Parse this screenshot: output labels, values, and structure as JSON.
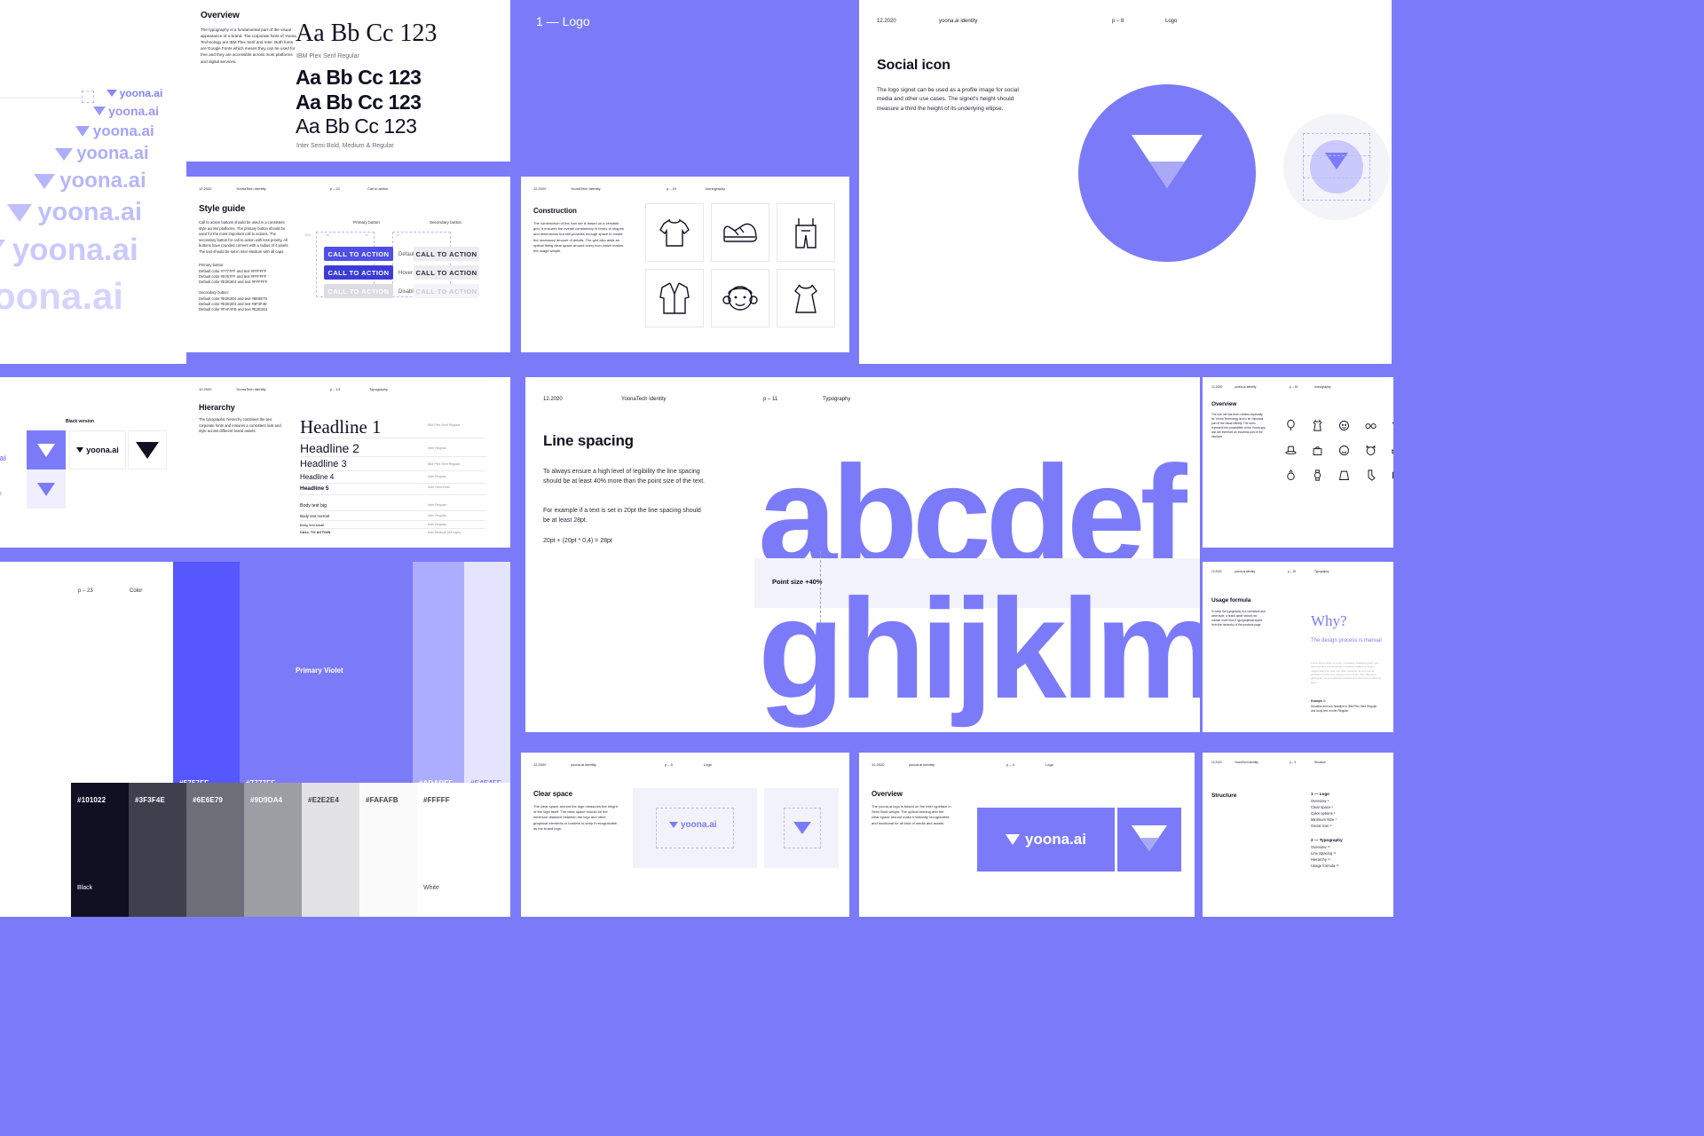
{
  "brand": {
    "name": "yoona.ai",
    "primary": "#7B7BFA",
    "primary_dark": "#4F4FE8",
    "ink": "#101022"
  },
  "logostack": {
    "rows": [
      "yoona.ai",
      "yoona.ai",
      "yoona.ai",
      "yoona.ai",
      "yoona.ai",
      "yoona.ai",
      "yoona.ai",
      "oona.ai"
    ]
  },
  "typography_overview": {
    "title": "Overview",
    "body": "The typography is a fundamental part of the visual appearance of a brand. The corporate fonts of Yoona Technology are IBM Plex Serif and Inter. Both fonts are Google Fonts which means they can be used for free and they are accessible across most platforms and digital services.",
    "specimens": [
      {
        "text": "Aa Bb Cc 123",
        "label": "IBM Plex Serif Regular",
        "style": "serif"
      },
      {
        "text": "Aa Bb Cc 123",
        "label": "",
        "style": "sans-bold"
      },
      {
        "text": "Aa Bb Cc 123",
        "label": "",
        "style": "sans-medium"
      },
      {
        "text": "Aa Bb Cc 123",
        "label": "Inter Semi Bold, Medium & Regular",
        "style": "sans-regular"
      }
    ]
  },
  "logo_section": {
    "title": "1 — Logo"
  },
  "social_icon": {
    "header": {
      "date": "12.2020",
      "identity": "yoona.ai identity",
      "page": "p – 8",
      "section": "Logo"
    },
    "title": "Social icon",
    "body": "The logo signet can be used as a profile image for social media and other use cases. The signet's height should measure a third the height of its underlying ellipse."
  },
  "style_guide": {
    "header": {
      "date": "12.2020",
      "identity": "YoonaTech Identity",
      "page": "p – 21",
      "section": "Call to action"
    },
    "title": "Style guide",
    "body": "Call to action buttons should be used in a consistent style across platforms. The primary button should be used for the most important call to actions. The secondary button for call to action with less priority. All buttons have rounded corners with a radius of 4 pixels. The text should be set in Inter Medium with all caps.",
    "primary_heading": "Primary button:",
    "primary_lines": [
      "Default color #7777FF and text #FFFFFF",
      "Default color #5757FF and text #FFFFFF",
      "Default color #E2E2E4 and text #FFFFFF"
    ],
    "secondary_heading": "Secondary button:",
    "secondary_lines": [
      "Default color #E2E2E4 and text #6E6E79",
      "Default color #E2E2E4 and text #3F3F4E",
      "Default color #FAFAFB and text #E2E2E4"
    ],
    "col_primary": "Primary button",
    "col_secondary": "Secondary button",
    "cta_label": "CALL TO ACTION",
    "states": [
      "Default",
      "Hover",
      "Disabled"
    ],
    "measure_labels": [
      "60x",
      "2x",
      "2x",
      "1x"
    ]
  },
  "construction": {
    "header": {
      "date": "12.2020",
      "identity": "YoonaTech Identity",
      "page": "p – 19",
      "section": "Iconography"
    },
    "title": "Construction",
    "body": "The construction of the icon set is based on a versatile grid. It ensures the overall consistency in terms of shapes and dimensions but still provides enough space to create the necessary amount of details. The grid also adds an optical fitting clear space around every icon which makes the usage simple.",
    "icons": [
      "t-shirt-icon",
      "sneaker-icon",
      "dungarees-icon",
      "coat-icon",
      "girl-face-icon",
      "dress-icon"
    ]
  },
  "hierarchy": {
    "header": {
      "date": "12.2020",
      "identity": "YoonaTech Identity",
      "page": "p – 13",
      "section": "Typography"
    },
    "title": "Hierarchy",
    "body": "The typographic hierarchy combines the two corporate fonts and ensures a consistent look and style across different brand assets.",
    "rows": [
      {
        "label": "Headline 1",
        "font": "IBM Plex Serif Regular",
        "size": 26,
        "style": "serif"
      },
      {
        "label": "Headline 2",
        "font": "Inter Regular",
        "size": 17,
        "style": "sans"
      },
      {
        "label": "Headline 3",
        "font": "IBM Plex Serif Regular",
        "size": 13,
        "style": "sans"
      },
      {
        "label": "Headline 4",
        "font": "Inter Regular",
        "size": 10,
        "style": "sans"
      },
      {
        "label": "Headline 5",
        "font": "Inter Semi Bold",
        "size": 8,
        "style": "sans-bold"
      },
      {
        "label": "Body text big",
        "font": "Inter Regular",
        "size": 7,
        "style": "sans"
      },
      {
        "label": "Body text normal",
        "font": "Inter Regular",
        "size": 6,
        "style": "sans"
      },
      {
        "label": "Body text small",
        "font": "Inter Regular",
        "size": 5,
        "style": "sans"
      },
      {
        "label": "CALL TO ACTION",
        "font": "Inter Medium (All caps)",
        "size": 5,
        "style": "sans-caps"
      }
    ]
  },
  "line_spacing": {
    "header": {
      "date": "12.2020",
      "identity": "YoonaTech Identity",
      "page": "p – 11",
      "section": "Typography"
    },
    "title": "Line spacing",
    "body1": "To always ensure a high level of legibility the line spacing should be at least 40% more than the point size of the text.",
    "body2": "For example if a text is set in 20pt the line spacing should be at least 28pt.",
    "formula": "20pt + (20pt * 0,4) = 28pt",
    "callout": "Point size +40%",
    "specimen_line1": "abcdef",
    "specimen_line2": "ghijklm"
  },
  "icon_overview": {
    "header": {
      "date": "12.2020",
      "identity": "yoona.ai identity",
      "page": "p – 16",
      "section": "Iconography"
    },
    "title": "Overview",
    "body": "The icon set has been created especially for Yoona Technology and is an important part of the visual identity. The icons represent the possibilities of the Yoona app and are therefore an essential part of the interface."
  },
  "usage_formula": {
    "header": {
      "date": "12.2020",
      "identity": "yoona.ai identity",
      "page": "p – 15",
      "section": "Typography"
    },
    "title": "Usage formula",
    "body": "To keep the typography in a consistent and clear style, a brand asset should not contain more than 3 typographical styles from the hierarchy of the previous page.",
    "why": "Why?",
    "sub": "The design process is manual",
    "filler": "Lorem ipsum dolor sit amet, consetetur sadipscing elitr, sed diam nonumy eirmod tempor invidunt ut labore et dolore magna aliquyam erat, sed diam voluptua. At vero eos et accusam et justo duo dolores et ea rebum. Stet clita kasd gubergren, no sea takimata sanctus est Lorem ipsum dolor sit amet.",
    "example_label": "Example 1:",
    "example_body": "Headline and sub headline in IBM Plex Serif Regular and body text in Inter Regular."
  },
  "color": {
    "page": "p – 23",
    "section": "Color",
    "primary_label": "Primary Violet",
    "black_label": "Black",
    "white_label": "White",
    "violet_swatches": [
      {
        "hex": "#5757FF",
        "color": "#5757FF",
        "text": "#FFFFFF"
      },
      {
        "hex": "#7777FF",
        "color": "#7B7BFA",
        "text": "#FFFFFF"
      },
      {
        "hex": "#ADADFF",
        "color": "#ADADFF",
        "text": "#FFFFFF"
      },
      {
        "hex": "#E4E4FF",
        "color": "#E4E4FF",
        "text": "#7B7BFA"
      }
    ],
    "gray_swatches": [
      {
        "hex": "#101022",
        "color": "#101022",
        "text": "#FFFFFF"
      },
      {
        "hex": "#3F3F4E",
        "color": "#3F3F4E",
        "text": "#FFFFFF"
      },
      {
        "hex": "#6E6E79",
        "color": "#6E6E79",
        "text": "#FFFFFF"
      },
      {
        "hex": "#9D9DA4",
        "color": "#9D9DA4",
        "text": "#FFFFFF"
      },
      {
        "hex": "#E2E2E4",
        "color": "#E2E2E4",
        "text": "#3F3F4E"
      },
      {
        "hex": "#FAFAFB",
        "color": "#FAFAFB",
        "text": "#3F3F4E"
      },
      {
        "hex": "#FAFAFB",
        "color": "#F4F4F7",
        "text": "#3F3F4E"
      },
      {
        "hex": "#FFFFF",
        "color": "#FFFFFF",
        "text": "#3F3F4E"
      }
    ]
  },
  "clear_space": {
    "header": {
      "date": "12.2020",
      "identity": "yoona.ai identity",
      "page": "p – 5",
      "section": "Logo"
    },
    "title": "Clear space",
    "body": "The clear space around the logo measures the height of the logo itself. The clear space should be the minimum distance between the logo and other graphical elements or borders to keep it recognizable as the brand logo.",
    "wordmark": "yoona.ai"
  },
  "logo_overview": {
    "header": {
      "date": "12.2020",
      "identity": "yoona.ai identity",
      "page": "p – 4",
      "section": "Logo"
    },
    "title": "Overview",
    "body": "The yoona.ai logo is based on the Inter typeface in Semi Bold weight. The optical kerning and the clear space around make it instantly recognizable and functional for all kind of media and assets.",
    "wordmark": "yoona.ai"
  },
  "structure": {
    "header": {
      "date": "12.2020",
      "identity": "YoonaTech Identity",
      "page": "p – 3",
      "section": "Structure"
    },
    "title": "Structure",
    "groups": [
      {
        "heading": "1 — Logo",
        "items": [
          "Overview ⁴",
          "Clear space ⁵",
          "Color options ⁶",
          "Minimum Size ⁷",
          "Social Icon ⁸"
        ]
      },
      {
        "heading": "2 — Typography",
        "items": [
          "Overview ¹⁰",
          "Line Spacing ¹¹",
          "Hierarchy ¹³",
          "Usage formula ¹⁵"
        ]
      }
    ]
  },
  "black_version": {
    "title": "Black version",
    "wordmark": "yoona.ai"
  }
}
